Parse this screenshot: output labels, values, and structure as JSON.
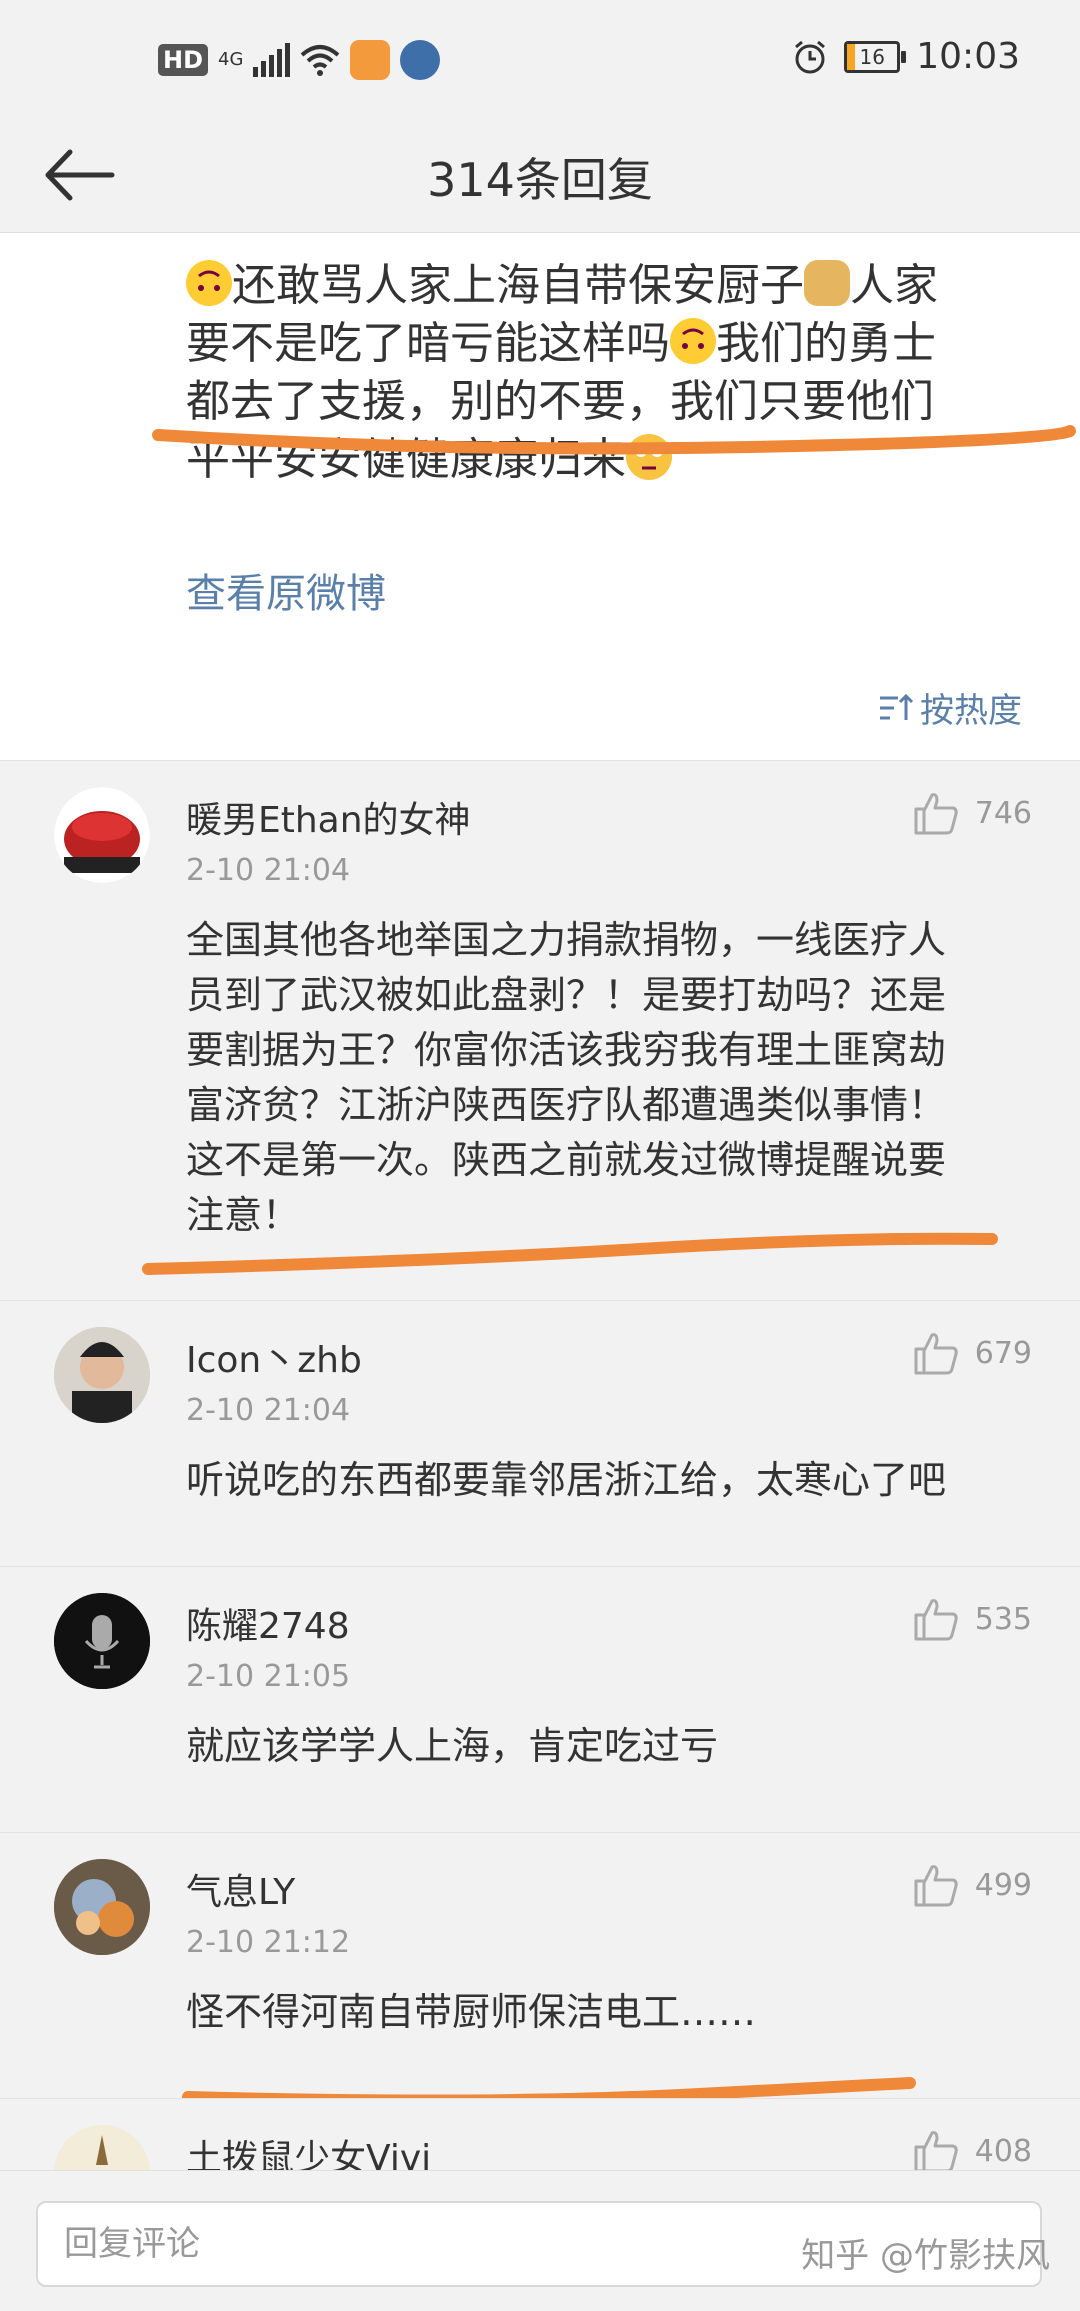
{
  "status_bar": {
    "hd": "HD",
    "network": "4G",
    "time": "10:03",
    "battery": "16"
  },
  "nav": {
    "title": "314条回复",
    "back_icon": "arrow-left-icon"
  },
  "post": {
    "line1a": "还敢骂人家上海自带保安厨子",
    "line1b": "人家",
    "line2a": "要不是吃了暗亏能这样吗",
    "line2b": "我们的勇士",
    "line3": "都去了支援，别的不要，我们只要他们",
    "line4": "平平安安健健康康归来",
    "view_original": "查看原微博",
    "sort_label": "按热度"
  },
  "comments": [
    {
      "name": "暖男Ethan的女神",
      "time": "2-10 21:04",
      "likes": "746",
      "lines": [
        "全国其他各地举国之力捐款捐物，一线医疗人",
        "员到了武汉被如此盘剥？！是要打劫吗？还是",
        "要割据为王？你富你活该我穷我有理土匪窝劫",
        "富济贫？江浙沪陕西医疗队都遭遇类似事情！",
        "这不是第一次。陕西之前就发过微博提醒说要",
        "注意！"
      ]
    },
    {
      "name": "Icon丶zhb",
      "time": "2-10 21:04",
      "likes": "679",
      "lines": [
        "听说吃的东西都要靠邻居浙江给，太寒心了吧"
      ]
    },
    {
      "name": "陈耀2748",
      "time": "2-10 21:05",
      "likes": "535",
      "lines": [
        "就应该学学人上海，肯定吃过亏"
      ]
    },
    {
      "name": "气息LY",
      "time": "2-10 21:12",
      "likes": "499",
      "lines": [
        "怪不得河南自带厨师保洁电工……"
      ]
    },
    {
      "name": "土拨鼠少女Vivi",
      "time": "",
      "likes": "408",
      "lines": []
    }
  ],
  "bottom": {
    "reply_placeholder": "回复评论",
    "watermark": "知乎 @竹影扶风"
  },
  "colors": {
    "link": "#5a7fa8",
    "underline": "#f0883a",
    "background": "#f2f2f2"
  }
}
